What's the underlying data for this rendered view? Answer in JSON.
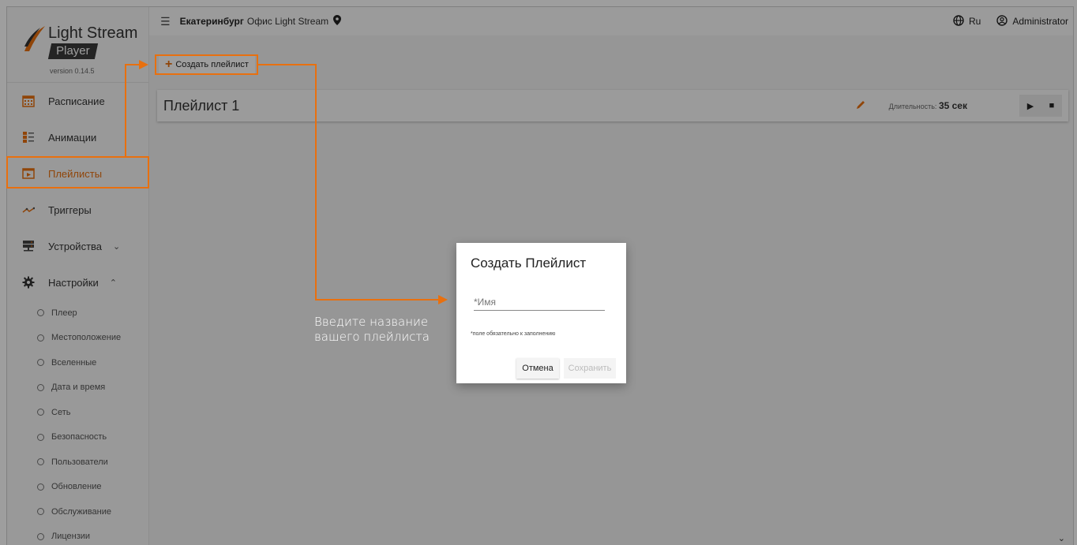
{
  "logo": {
    "title": "Light Stream",
    "badge": "Player",
    "version": "version 0.14.5"
  },
  "sidebar": {
    "items": [
      {
        "label": "Расписание",
        "icon": "calendar-icon"
      },
      {
        "label": "Анимации",
        "icon": "list-icon"
      },
      {
        "label": "Плейлисты",
        "icon": "playlist-icon",
        "active": true
      },
      {
        "label": "Триггеры",
        "icon": "trigger-icon"
      },
      {
        "label": "Устройства",
        "icon": "server-icon",
        "chevron": "down"
      },
      {
        "label": "Настройки",
        "icon": "gear-icon",
        "chevron": "up"
      }
    ],
    "subitems": [
      "Плеер",
      "Местоположение",
      "Вселенные",
      "Дата и время",
      "Сеть",
      "Безопасность",
      "Пользователи",
      "Обновление",
      "Обслуживание",
      "Лицензии"
    ]
  },
  "topbar": {
    "city": "Екатеринбург",
    "office": "Офис Light Stream",
    "language": "Ru",
    "user": "Administrator"
  },
  "main": {
    "create_button": "Создать плейлист",
    "playlist": {
      "name": "Плейлист 1",
      "duration_label": "Длительность:",
      "duration_value": "35 сек"
    }
  },
  "tutorial": {
    "note_line1": "Введите название",
    "note_line2": "вашего плейлиста"
  },
  "dialog": {
    "title": "Создать Плейлист",
    "name_placeholder": "*Имя",
    "required_note": "*поле обязательно к заполнению",
    "cancel": "Отмена",
    "save": "Сохранить"
  },
  "colors": {
    "accent": "#e8700f",
    "overlay": "rgba(0,0,0,0.38)"
  }
}
